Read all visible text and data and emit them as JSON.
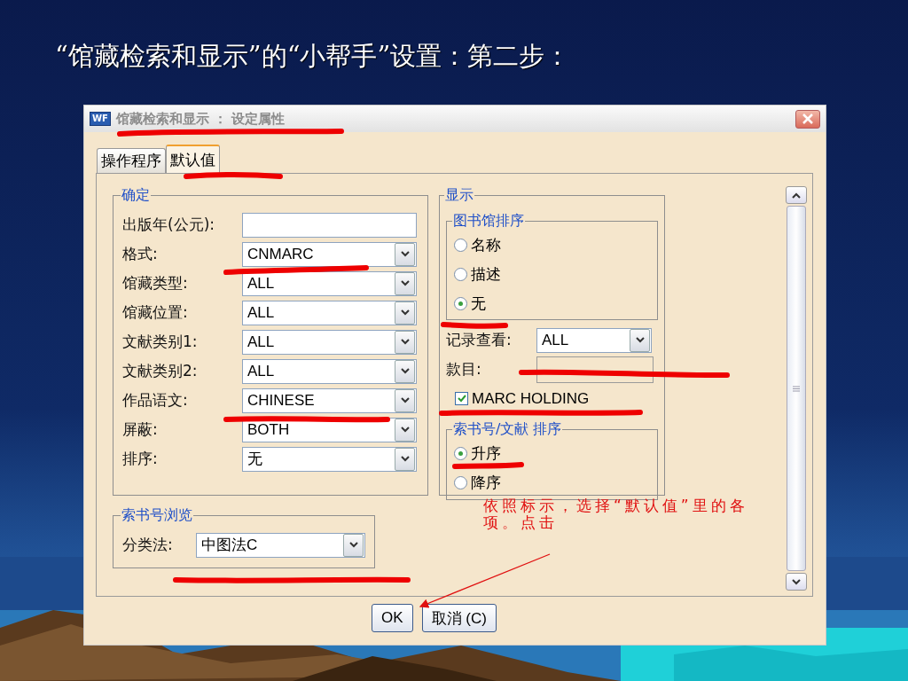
{
  "slide_title": "“馆藏检索和显示”的“小帮手”设置：第二步：",
  "dialog": {
    "app_logo": "WF",
    "title": "馆藏检索和显示 ： 设定属性"
  },
  "tabs": [
    {
      "label": "操作程序",
      "selected": false
    },
    {
      "label": "默认值",
      "selected": true
    }
  ],
  "confirm_group": {
    "legend": "确定",
    "fields": [
      {
        "label": "出版年(公元):",
        "kind": "text"
      },
      {
        "label": "格式:",
        "kind": "select",
        "value": "CNMARC"
      },
      {
        "label": "馆藏类型:",
        "kind": "select",
        "value": "ALL"
      },
      {
        "label": "馆藏位置:",
        "kind": "select",
        "value": "ALL"
      },
      {
        "label": "文献类别1:",
        "kind": "select",
        "value": "ALL"
      },
      {
        "label": "文献类别2:",
        "kind": "select",
        "value": "ALL"
      },
      {
        "label": "作品语文:",
        "kind": "select",
        "value": "CHINESE"
      },
      {
        "label": "屏蔽:",
        "kind": "select",
        "value": "BOTH"
      },
      {
        "label": "排序:",
        "kind": "select",
        "value": "无"
      }
    ]
  },
  "display_group": {
    "legend": "显示",
    "library_sort": {
      "legend": "图书馆排序",
      "options": [
        {
          "label": "名称",
          "selected": false
        },
        {
          "label": "描述",
          "selected": false
        },
        {
          "label": "无",
          "selected": true
        }
      ]
    },
    "record_view": {
      "label": "记录查看:",
      "value": "ALL"
    },
    "entry": {
      "label": "款目:"
    },
    "marc_holding": {
      "label": "MARC HOLDING",
      "checked": true
    },
    "call_sort": {
      "legend": "索书号/文献 排序",
      "options": [
        {
          "label": "升序",
          "selected": true
        },
        {
          "label": "降序",
          "selected": false
        }
      ]
    }
  },
  "call_browse": {
    "legend": "索书号浏览",
    "label": "分类法:",
    "value": "中图法C"
  },
  "annotation": "依照标示，选择“默认值”里的各项。点击",
  "buttons": [
    {
      "label": "OK"
    },
    {
      "label": "取消 (C)"
    }
  ]
}
